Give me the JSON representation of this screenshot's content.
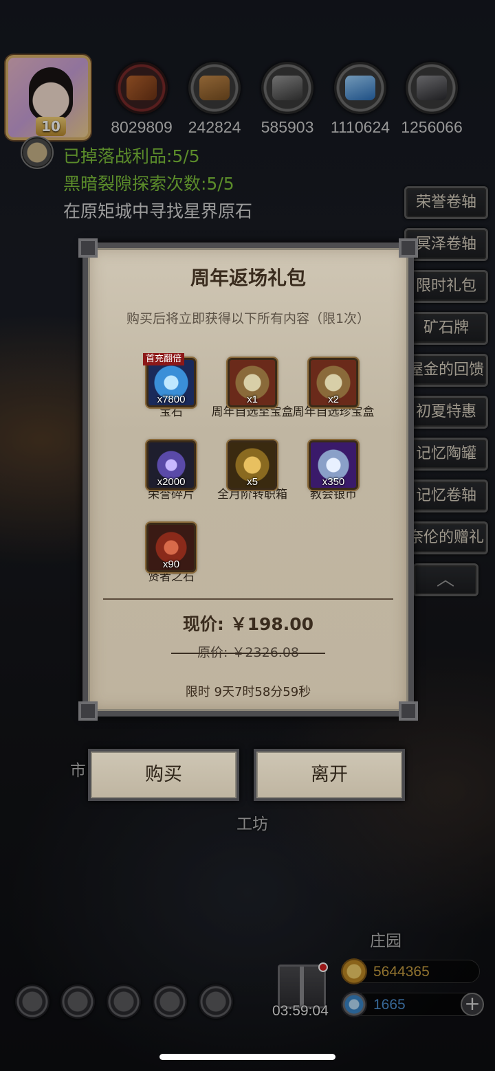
{
  "resources": [
    {
      "icon": "meat-icon",
      "value": "8029809"
    },
    {
      "icon": "wood-icon",
      "value": "242824"
    },
    {
      "icon": "iron-icon",
      "value": "585903"
    },
    {
      "icon": "crystal-icon",
      "value": "1110624"
    },
    {
      "icon": "ore-icon",
      "value": "1256066"
    }
  ],
  "player": {
    "level": "10"
  },
  "quests": {
    "loot": "已掉落战利品:5/5",
    "rift": "黑暗裂隙探索次数:5/5",
    "task": "在原矩城中寻找星界原石"
  },
  "side_menu": [
    "荣誉卷轴",
    "冥泽卷轴",
    "限时礼包",
    "矿石牌",
    "屋金的回馈",
    "初夏特惠",
    "记忆陶罐",
    "记忆卷轴",
    "奈伦的赠礼"
  ],
  "side_menu_collapse": "︿",
  "map_labels": {
    "market": "市",
    "workshop": "工坊",
    "manor": "庄园"
  },
  "modal": {
    "title": "周年返场礼包",
    "subtitle": "购买后将立即获得以下所有内容（限1次）",
    "items": [
      {
        "name": "宝石",
        "count": "x7800",
        "badge": "首充翻倍"
      },
      {
        "name": "周年自选至宝盒",
        "count": "x1"
      },
      {
        "name": "周年自选珍宝盒",
        "count": "x2"
      },
      {
        "name": "荣誉碎片",
        "count": "x2000"
      },
      {
        "name": "全月阶转职箱",
        "count": "x5"
      },
      {
        "name": "教会银币",
        "count": "x350"
      },
      {
        "name": "贤者之石",
        "count": "x90"
      }
    ],
    "price_now": "现价: ￥198.00",
    "price_old": "原价: ￥2326.08",
    "time_limit": "限时 9天7时58分59秒"
  },
  "buttons": {
    "buy": "购买",
    "leave": "离开"
  },
  "bottom": {
    "gift_timer": "03:59:04",
    "gold": "5644365",
    "gems": "1665",
    "plus": "+"
  },
  "colors": {
    "quest_green": "#7ec23b",
    "gold_text": "#c9a042",
    "gem_text": "#4d8fd0",
    "badge_red": "#8c1818"
  }
}
